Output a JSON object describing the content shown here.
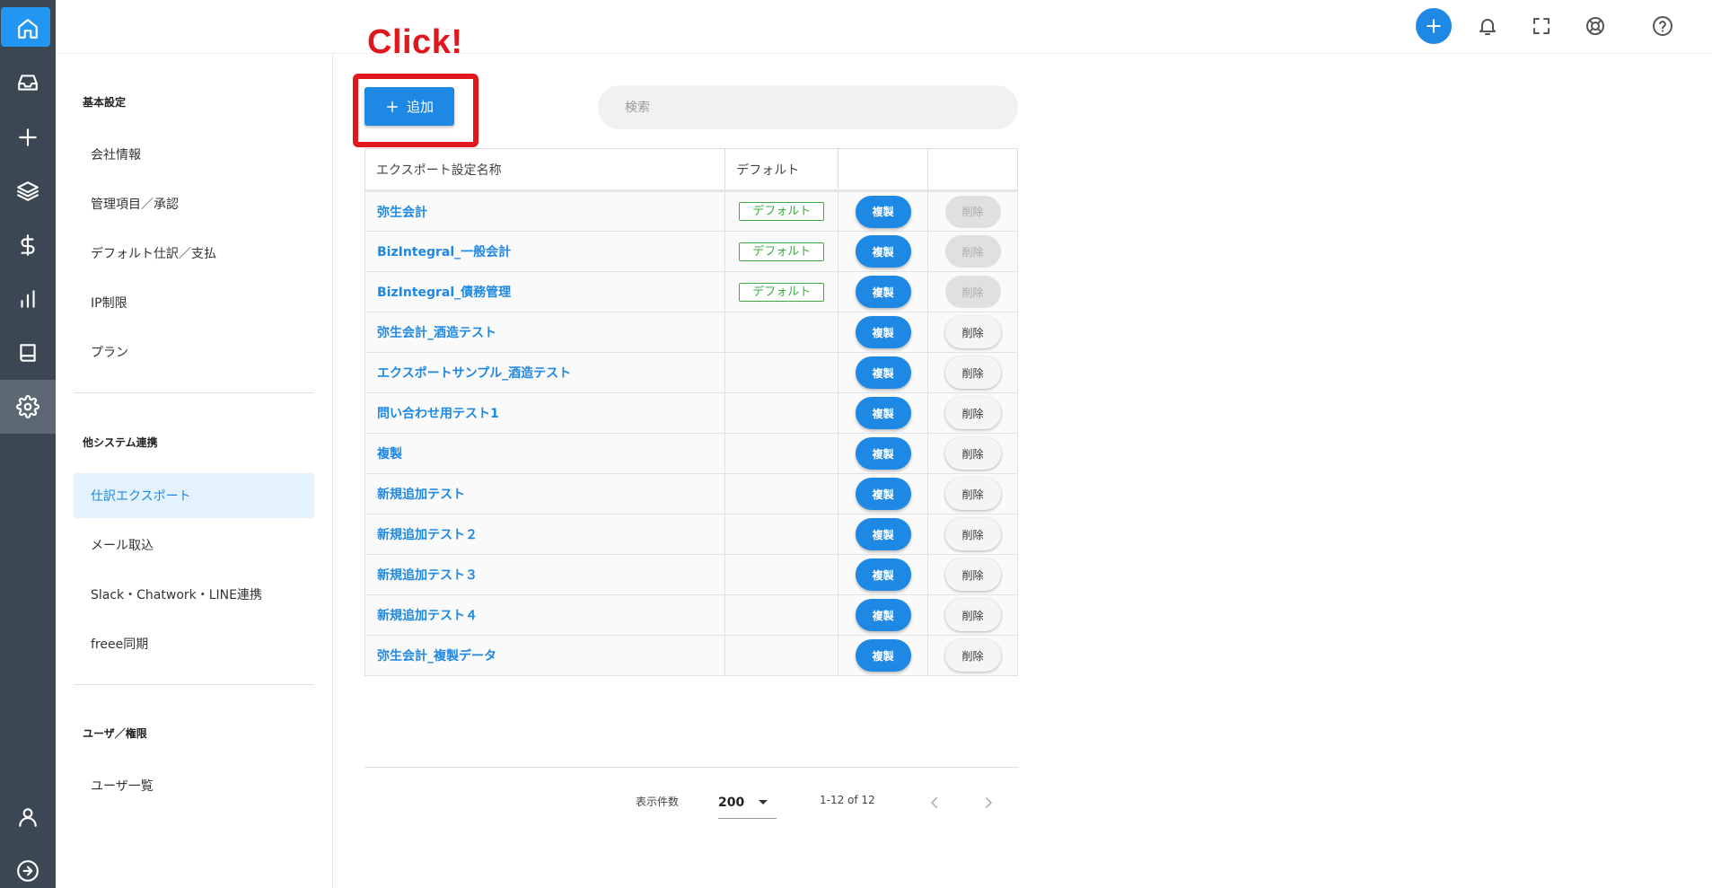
{
  "annotation": {
    "text": "Click!"
  },
  "rail": {
    "items": [
      "home-icon",
      "inbox-icon",
      "plus-icon",
      "layers-icon",
      "dollar-icon",
      "bar-chart-icon",
      "book-icon",
      "gear-icon",
      "user-icon",
      "arrow-right-circle-icon"
    ],
    "active": "gear-icon"
  },
  "topbar": {
    "icons": [
      "plus-icon",
      "bell-icon",
      "fullscreen-icon",
      "lifebuoy-icon",
      "help-icon"
    ]
  },
  "sidebar": {
    "sections": [
      {
        "title": "基本設定",
        "items": [
          "会社情報",
          "管理項目／承認",
          "デフォルト仕訳／支払",
          "IP制限",
          "プラン"
        ]
      },
      {
        "title": "他システム連携",
        "items": [
          "仕訳エクスポート",
          "メール取込",
          "Slack・Chatwork・LINE連携",
          "freee同期"
        ]
      },
      {
        "title": "ユーザ／権限",
        "items": [
          "ユーザ一覧"
        ]
      }
    ],
    "active_item": "仕訳エクスポート"
  },
  "toolbar": {
    "add_label": "追加",
    "search_placeholder": "検索"
  },
  "table": {
    "headers": [
      "エクスポート設定名称",
      "デフォルト",
      "",
      ""
    ],
    "copy_label": "複製",
    "delete_label": "削除",
    "default_badge": "デフォルト",
    "rows": [
      {
        "name": "弥生会計",
        "default": true
      },
      {
        "name": "BizIntegral_一般会計",
        "default": true
      },
      {
        "name": "BizIntegral_債務管理",
        "default": true
      },
      {
        "name": "弥生会計_酒造テスト",
        "default": false
      },
      {
        "name": "エクスポートサンプル_酒造テスト",
        "default": false
      },
      {
        "name": "問い合わせ用テスト1",
        "default": false
      },
      {
        "name": "複製",
        "default": false
      },
      {
        "name": "新規追加テスト",
        "default": false
      },
      {
        "name": "新規追加テスト２",
        "default": false
      },
      {
        "name": "新規追加テスト３",
        "default": false
      },
      {
        "name": "新規追加テスト４",
        "default": false
      },
      {
        "name": "弥生会計_複製データ",
        "default": false
      }
    ]
  },
  "pagination": {
    "rows_label": "表示件数",
    "rows_per_page": "200",
    "range": "1-12 of 12"
  },
  "colors": {
    "accent": "#1e88e5",
    "rail": "#3b4752",
    "badge": "#3fa94a",
    "annotation": "#e0181d"
  }
}
